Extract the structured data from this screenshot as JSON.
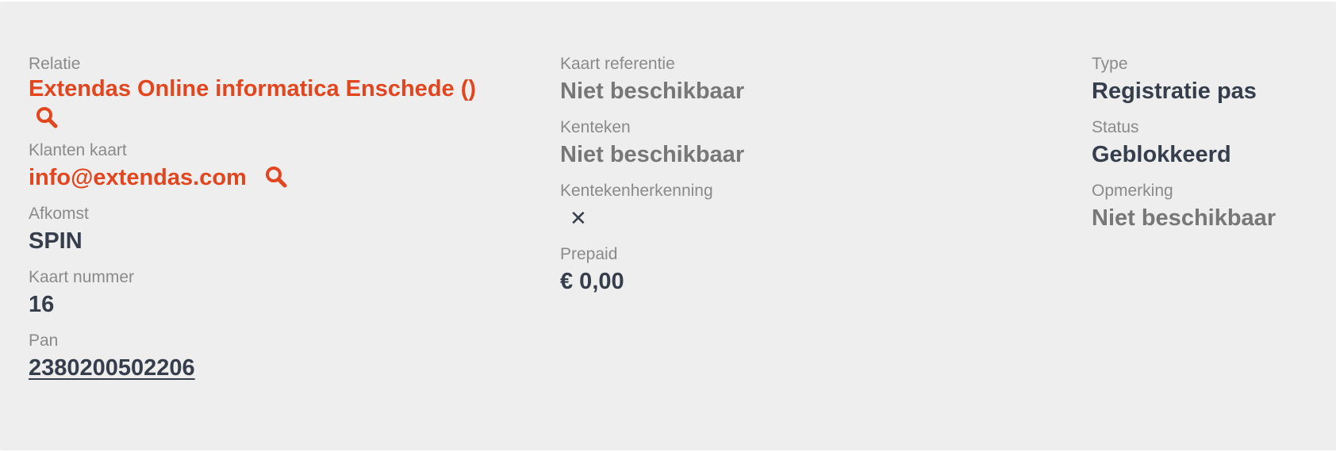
{
  "fields": {
    "relatie": {
      "label": "Relatie",
      "value": "Extendas Online informatica Enschede ()"
    },
    "klanten_kaart": {
      "label": "Klanten kaart",
      "value": "info@extendas.com"
    },
    "afkomst": {
      "label": "Afkomst",
      "value": "SPIN"
    },
    "kaart_nummer": {
      "label": "Kaart nummer",
      "value": "16"
    },
    "pan": {
      "label": "Pan",
      "value": "2380200502206"
    },
    "kaart_referentie": {
      "label": "Kaart referentie",
      "value": "Niet beschikbaar"
    },
    "kenteken": {
      "label": "Kenteken",
      "value": "Niet beschikbaar"
    },
    "kentekenherkenning": {
      "label": "Kentekenherkenning",
      "value": "✕",
      "icon": "cross-icon"
    },
    "prepaid": {
      "label": "Prepaid",
      "value": "€ 0,00"
    },
    "type": {
      "label": "Type",
      "value": "Registratie pas"
    },
    "status": {
      "label": "Status",
      "value": "Geblokkeerd"
    },
    "opmerking": {
      "label": "Opmerking",
      "value": "Niet beschikbaar"
    }
  },
  "colors": {
    "background": "#eeeeee",
    "label": "#8a8a8a",
    "value": "#363d4b",
    "muted_value": "#777777",
    "link": "#e2461f"
  },
  "icons": {
    "search": "search-icon",
    "cross": "cross-icon"
  }
}
